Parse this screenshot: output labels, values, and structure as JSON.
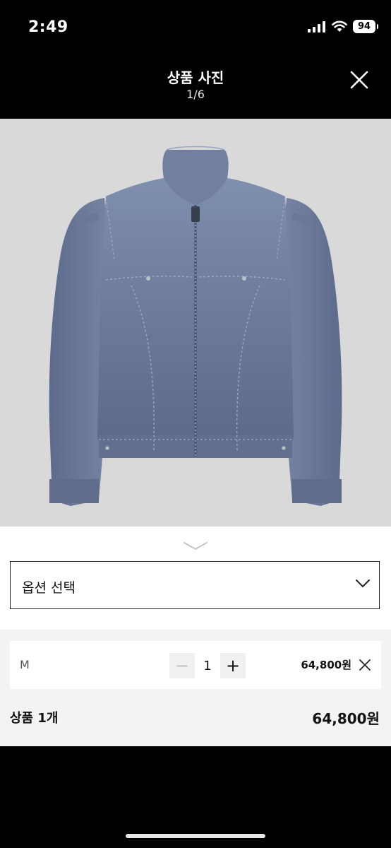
{
  "status_bar": {
    "time": "2:49",
    "battery": "94"
  },
  "header": {
    "title": "상품 사진",
    "counter": "1/6"
  },
  "photo": {
    "subject": "denim-jacket"
  },
  "option_selector": {
    "placeholder": "옵션 선택"
  },
  "cart_item": {
    "size": "M",
    "quantity": "1",
    "price": "64,800원",
    "minus": "−",
    "plus": "+"
  },
  "summary": {
    "label": "상품 1개",
    "total": "64,800원"
  },
  "colors": {
    "sheet": "#ffffff",
    "cart_bg": "#f3f3f3",
    "photo_bg": "#d8d9d8",
    "denim": "#6f7e9b"
  }
}
